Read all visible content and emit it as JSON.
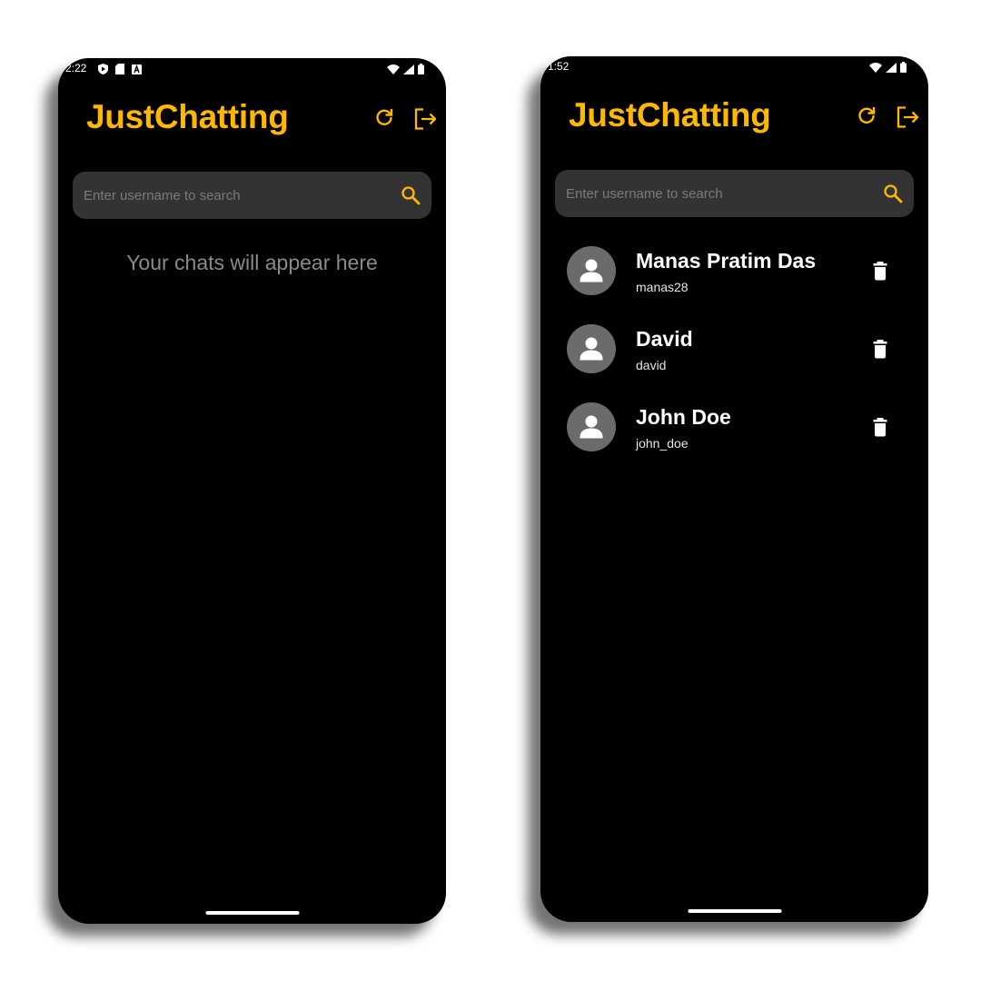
{
  "left_screen": {
    "status_time": "2:22",
    "app_title": "JustChatting",
    "search_placeholder": "Enter username to search",
    "empty_message": "Your chats will appear here"
  },
  "right_screen": {
    "status_time": "1:52",
    "app_title": "JustChatting",
    "search_placeholder": "Enter username to search",
    "chats": [
      {
        "name": "Manas Pratim Das",
        "username": "manas28"
      },
      {
        "name": "David",
        "username": "david"
      },
      {
        "name": "John Doe",
        "username": "john_doe"
      }
    ]
  },
  "icons": {
    "status_left": [
      "shield-play-icon",
      "sd-card-icon",
      "a-box-icon"
    ],
    "status_right": [
      "wifi-icon",
      "cell-signal-icon",
      "battery-icon"
    ],
    "header": [
      "refresh-icon",
      "logout-icon"
    ],
    "search": "search-icon",
    "chat_item": [
      "person-avatar-icon",
      "trash-icon"
    ]
  },
  "colors": {
    "accent": "#FFB800",
    "background": "#000000",
    "search_bg": "#333333",
    "placeholder": "#7A7A7A",
    "empty_text": "#8A8A8A",
    "avatar_bg": "#6B6B6B",
    "text_primary": "#FFFFFF"
  }
}
